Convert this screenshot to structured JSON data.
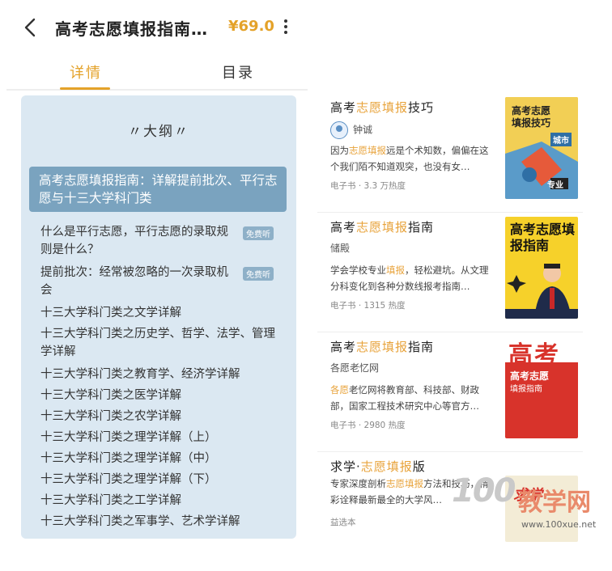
{
  "header": {
    "title": "高考志愿填报指南…",
    "price": "¥69.0"
  },
  "tabs": [
    {
      "label": "详情"
    },
    {
      "label": "目录"
    }
  ],
  "outline": {
    "heading": "〃大纲〃",
    "chapter": "高考志愿填报指南：详解提前批次、平行志愿与十三大学科门类",
    "free_badge": "免费听",
    "items": [
      "什么是平行志愿，平行志愿的录取规则是什么？",
      "提前批次：经常被忽略的一次录取机会",
      "十三大学科门类之文学详解",
      "十三大学科门类之历史学、哲学、法学、管理学详解",
      "十三大学科门类之教育学、经济学详解",
      "十三大学科门类之医学详解",
      "十三大学科门类之农学详解",
      "十三大学科门类之理学详解（上）",
      "十三大学科门类之理学详解（中）",
      "十三大学科门类之理学详解（下）",
      "十三大学科门类之工学详解",
      "十三大学科门类之军事学、艺术学详解"
    ]
  },
  "recommendations": [
    {
      "title_pre": "高考",
      "title_hl": "志愿填报",
      "title_post": "技巧",
      "author": "钟诚",
      "desc_pre": "因为",
      "desc_hl": "志愿填报",
      "desc_post": "远是个术知数，偏偏在这个我们陌不知道观突，也没有女…",
      "meta": "电子书 · 3.3 万热度",
      "cover_text": "高考志愿填报技巧",
      "cover_sub": "城市",
      "cover_sub2": "专业"
    },
    {
      "title_pre": "高考",
      "title_hl": "志愿填报",
      "title_post": "指南",
      "author": "储殿",
      "desc_pre": "学会学校专业",
      "desc_hl": "填报",
      "desc_post": "，轻松避坑。从文理分科变化到各种分数线报考指南…",
      "meta": "电子书 · 1315 热度",
      "cover_text": "高考志愿填报指南"
    },
    {
      "title_pre": "高考",
      "title_hl": "志愿填报",
      "title_post": "指南",
      "author": "各愿老忆网",
      "desc_pre": "",
      "desc_hl": "各愿",
      "desc_post": "老忆网将教育部、科技部、财政部，国家工程技术研究中心等官方…",
      "meta": "电子书 · 2980 热度",
      "cover_text": "高考",
      "cover_sub": "高考志愿",
      "cover_sub2": "填报指南"
    },
    {
      "title_pre": "求学·",
      "title_hl": "志愿填报",
      "title_post": "版",
      "author": "",
      "desc_pre": "专家深度剖析",
      "desc_hl": "志愿填报",
      "desc_post": "方法和技巧，精彩诠释最新最全的大学风…",
      "meta": "益选本",
      "cover_text": "求学"
    }
  ],
  "watermark": {
    "logo": "100",
    "text": "教学网",
    "url": "www.100xue.net"
  },
  "colors": {
    "accent": "#e4a229",
    "outline_bg": "#dbe8f2",
    "chapter_bg": "#7aa3bf",
    "cover_red": "#d8332b"
  }
}
